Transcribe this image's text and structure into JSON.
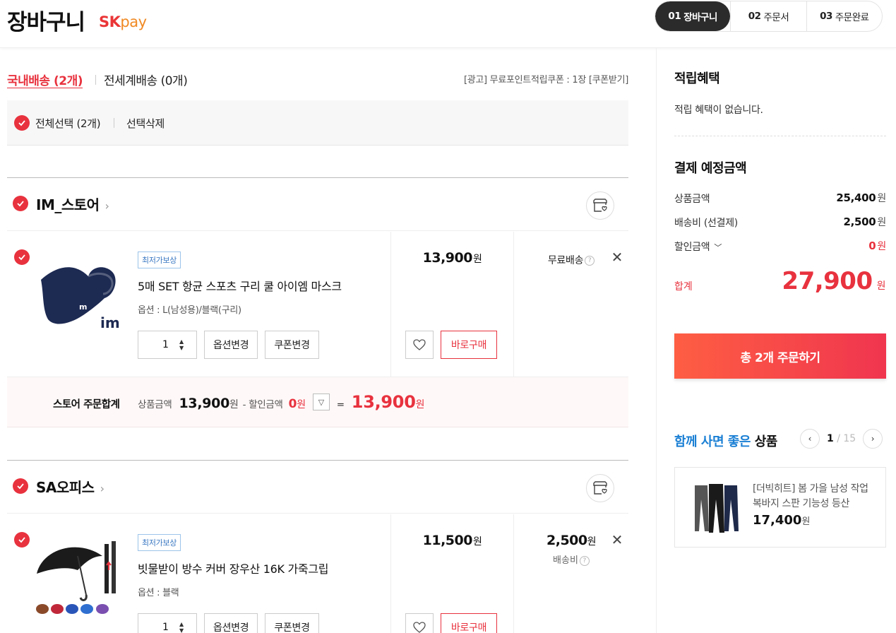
{
  "header": {
    "title": "장바구니",
    "brand_sk": "SK",
    "brand_pay": "pay",
    "steps": [
      {
        "num": "01",
        "label": "장바구니"
      },
      {
        "num": "02",
        "label": "주문서"
      },
      {
        "num": "03",
        "label": "주문완료"
      }
    ]
  },
  "tabs": {
    "domestic": "국내배송 (2개)",
    "global": "전세계배송 (0개)",
    "coupon_link": "[광고] 무료포인트적립쿠폰 : 1장 [쿠폰받기]"
  },
  "select_bar": {
    "select_all": "전체선택 (2개)",
    "delete_selected": "선택삭제"
  },
  "stores": [
    {
      "name": "IM_스토어",
      "item": {
        "badge": "최저가보상",
        "name": "5매 SET 항균 스포츠 구리 쿨 아이엠 마스크",
        "option": "옵션 : L(남성용)/블랙(구리)",
        "quantity": "1",
        "price": "13,900",
        "shipping": "무료배송"
      }
    },
    {
      "name": "SA오피스",
      "item": {
        "badge": "최저가보상",
        "name": "빗물받이 방수 커버 장우산 16K 가죽그립",
        "option": "옵션 : 블랙",
        "quantity": "1",
        "price": "11,500",
        "shipping_price": "2,500",
        "shipping_label": "배송비"
      }
    }
  ],
  "buttons": {
    "change_option": "옵션변경",
    "change_coupon": "쿠폰변경",
    "buy_now": "바로구매"
  },
  "currency": "원",
  "store_total": {
    "label": "스토어 주문합계",
    "product_label": "상품금액",
    "product_amount": "13,900",
    "discount_label": "- 할인금액",
    "discount_amount": "0",
    "equals": "=",
    "total": "13,900"
  },
  "summary": {
    "benefit_title": "적립혜택",
    "benefit_text": "적립 혜택이 없습니다.",
    "payment_title": "결제 예정금액",
    "rows": [
      {
        "label": "상품금액",
        "value": "25,400"
      },
      {
        "label": "배송비 (선결제)",
        "value": "2,500"
      },
      {
        "label": "할인금액",
        "value": "0"
      }
    ],
    "total_label": "합계",
    "total_value": "27,900",
    "order_button": "총 2개 주문하기"
  },
  "recommend": {
    "title_blue": "함께 사면 좋은",
    "title_rest": "상품",
    "page_current": "1",
    "page_sep": "/",
    "page_total": "15",
    "product_name": "[더빅히트] 봄 가을 남성 작업복바지 스판 기능성 등산",
    "product_price": "17,400"
  },
  "colors": {
    "accent": "#e8323e",
    "blue": "#1a7fd4",
    "dark": "#2b2b2b"
  }
}
